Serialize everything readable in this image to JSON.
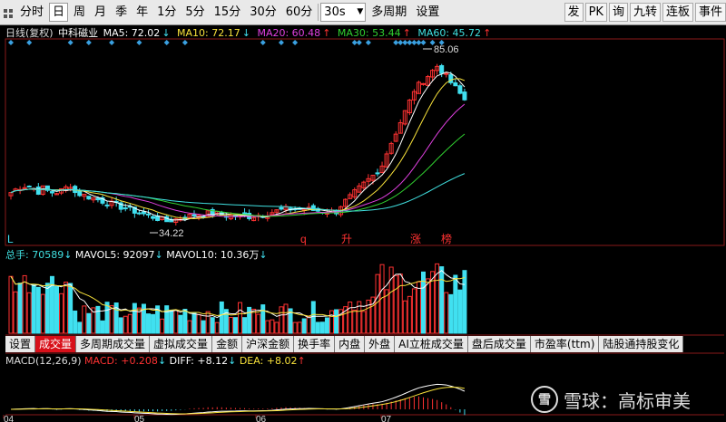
{
  "toolbar": {
    "periods": [
      "分时",
      "日",
      "周",
      "月",
      "季",
      "年",
      "1分",
      "5分",
      "15分",
      "30分",
      "60分"
    ],
    "active_period": "日",
    "interval_select": "30s",
    "multi_period": "多周期",
    "settings": "设置",
    "right_buttons": [
      "发",
      "PK",
      "询",
      "九转",
      "连板",
      "事件"
    ]
  },
  "price_header": {
    "mode": "日线(复权)",
    "stock_name": "中科磁业",
    "ma5": {
      "label": "MA5: 72.02",
      "arrow": "↓",
      "color": "#ffffff"
    },
    "ma10": {
      "label": "MA10: 72.17",
      "arrow": "↓",
      "color": "#f7e13a"
    },
    "ma20": {
      "label": "MA20: 60.48",
      "arrow": "↑",
      "color": "#e040e0"
    },
    "ma30": {
      "label": "MA30: 53.44",
      "arrow": "↑",
      "color": "#30d030"
    },
    "ma60": {
      "label": "MA60: 45.72",
      "arrow": "↑",
      "color": "#40e0e0"
    }
  },
  "annotations": {
    "high": "85.06",
    "low": "34.22",
    "markers": [
      "L",
      "q",
      "升",
      "涨",
      "榜"
    ]
  },
  "volume_header": {
    "total": "总手: 70589",
    "total_arrow": "↓",
    "mavol5": "MAVOL5: 92097",
    "mavol5_arrow": "↓",
    "mavol10": "MAVOL10: 10.36万",
    "mavol10_arrow": "↓"
  },
  "tabs": [
    "设置",
    "成交量",
    "多周期成交量",
    "虚拟成交量",
    "金额",
    "沪深金额",
    "换手率",
    "内盘",
    "外盘",
    "AI立桩成交量",
    "盘后成交量",
    "市盈率(ttm)",
    "陆股通持股变化"
  ],
  "active_tab": "成交量",
  "macd_header": {
    "title": "MACD(12,26,9)",
    "macd": "MACD: +0.208",
    "macd_arrow": "↓",
    "diff": "DIFF: +8.12",
    "diff_arrow": "↓",
    "dea": "DEA: +8.02",
    "dea_arrow": "↑"
  },
  "x_axis_months": [
    "04",
    "05",
    "06",
    "07"
  ],
  "watermark": {
    "logo": "雪",
    "text": "雪球：高标审美"
  },
  "colors": {
    "up": "#ff3232",
    "down": "#40e0f0",
    "bg": "#000000",
    "toolbar": "#e9e9e9",
    "active_tab": "#d8101a",
    "marker": "#3aa0e0"
  }
}
